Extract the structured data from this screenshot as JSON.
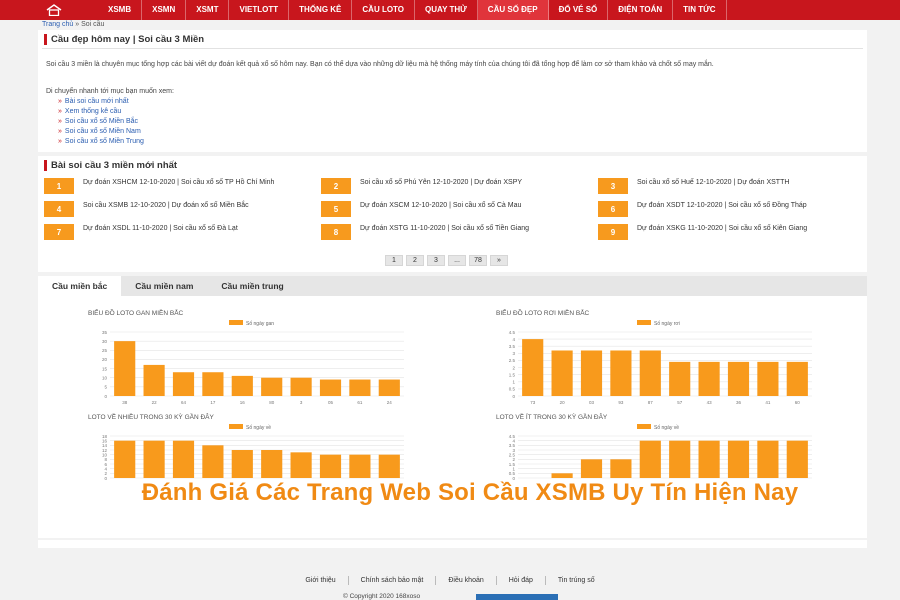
{
  "nav": {
    "items": [
      {
        "label": "XSMB"
      },
      {
        "label": "XSMN"
      },
      {
        "label": "XSMT"
      },
      {
        "label": "VIETLOTT"
      },
      {
        "label": "THỐNG KÊ"
      },
      {
        "label": "CẦU LOTO"
      },
      {
        "label": "QUAY THỬ"
      },
      {
        "label": "CẦU SỐ ĐẸP",
        "active": true
      },
      {
        "label": "ĐỔ VÉ SỐ"
      },
      {
        "label": "ĐIỆN TOÁN"
      },
      {
        "label": "TIN TỨC"
      }
    ],
    "color": "#c8161d"
  },
  "breadcrumb": {
    "home": "Trang chủ",
    "sep": " » ",
    "current": "Soi cầu"
  },
  "intro_panel": {
    "title": "Cầu đẹp hôm nay | Soi cầu 3 Miền",
    "text": "Soi cầu 3 miền là chuyên mục tổng hợp các bài viết dự đoán kết quả xổ số hôm nay. Bạn có thể dựa vào những dữ liệu mà hệ thống máy tính của chúng tôi đã tổng hợp để làm cơ sở tham khảo và chốt số may mắn.",
    "nav_intro": "Di chuyển nhanh tới mục bạn muốn xem:",
    "links": [
      "Bài soi cầu mới nhất",
      "Xem thống kê cầu",
      "Soi cầu xổ số Miền Bắc",
      "Soi cầu xổ số Miền Nam",
      "Soi cầu xổ số Miền Trung"
    ]
  },
  "posts_panel": {
    "title": "Bài soi cầu 3 miền mới nhất",
    "posts": [
      {
        "num": "1",
        "text": "Dự đoán XSHCM 12-10-2020 | Soi cầu xổ số TP Hồ Chí Minh"
      },
      {
        "num": "2",
        "text": "Soi cầu xổ số Phú Yên 12-10-2020 | Dự đoán XSPY"
      },
      {
        "num": "3",
        "text": "Soi cầu xổ số Huế 12-10-2020 | Dự đoán XSTTH"
      },
      {
        "num": "4",
        "text": "Soi cầu XSMB 12-10-2020 | Dự đoán xổ số Miền Bắc"
      },
      {
        "num": "5",
        "text": "Dự đoán XSCM 12-10-2020 | Soi cầu xổ số Cà Mau"
      },
      {
        "num": "6",
        "text": "Dự đoán XSDT 12-10-2020 | Soi cầu xổ số Đồng Tháp"
      },
      {
        "num": "7",
        "text": "Dự đoán XSDL 11-10-2020 | Soi cầu xổ số Đà Lạt"
      },
      {
        "num": "8",
        "text": "Dự đoán XSTG 11-10-2020 | Soi cầu xổ số Tiền Giang"
      },
      {
        "num": "9",
        "text": "Dự đoán XSKG 11-10-2020 | Soi cầu xổ số Kiên Giang"
      }
    ],
    "pager": [
      "1",
      "2",
      "3",
      "...",
      "78",
      "»"
    ],
    "accent": "#f79a1e"
  },
  "stats_panel": {
    "tabs": [
      {
        "label": "Cầu miền bắc",
        "active": true
      },
      {
        "label": "Cầu miền nam"
      },
      {
        "label": "Cầu miền trung"
      }
    ]
  },
  "chart_data": [
    {
      "type": "bar",
      "title": "BIỂU ĐỒ LOTO GAN MIỀN BẮC",
      "series": [
        {
          "name": "Số ngày gan",
          "values": [
            30,
            17,
            13,
            13,
            11,
            10,
            10,
            9,
            9,
            9
          ]
        }
      ],
      "categories": [
        "38",
        "22",
        "64",
        "17",
        "16",
        "80",
        "3",
        "05",
        "61",
        "24"
      ],
      "ylim": [
        0,
        35
      ],
      "yticks": [
        0,
        5,
        10,
        15,
        20,
        25,
        30,
        35
      ],
      "color": "#f89a1c"
    },
    {
      "type": "bar",
      "title": "BIỂU ĐỒ LOTO RƠI MIỀN BẮC",
      "series": [
        {
          "name": "Số ngày rơi",
          "values": [
            4.0,
            3.2,
            3.2,
            3.2,
            3.2,
            2.4,
            2.4,
            2.4,
            2.4,
            2.4
          ]
        }
      ],
      "categories": [
        "73",
        "20",
        "03",
        "93",
        "87",
        "57",
        "43",
        "36",
        "41",
        "60"
      ],
      "ylim": [
        0,
        4.5
      ],
      "yticks": [
        0,
        0.5,
        1.0,
        1.5,
        2.0,
        2.5,
        3.0,
        3.5,
        4.0,
        4.5
      ],
      "color": "#f89a1c"
    },
    {
      "type": "bar",
      "title": "LOTO VỀ NHIỀU TRONG 30 KỲ GẦN ĐÂY",
      "series": [
        {
          "name": "Số ngày về",
          "values": [
            16,
            16,
            16,
            14,
            12,
            12,
            11,
            10,
            10,
            10
          ]
        }
      ],
      "categories": [],
      "ylim": [
        0,
        18
      ],
      "yticks": [
        0,
        2,
        4,
        6,
        8,
        10,
        12,
        14,
        16,
        18
      ],
      "color": "#f89a1c"
    },
    {
      "type": "bar",
      "title": "LOTO VỀ ÍT TRONG 30 KỲ GẦN ĐÂY",
      "series": [
        {
          "name": "Số ngày về",
          "values": [
            0,
            0.5,
            2.0,
            2.0,
            4.0,
            4.0,
            4.0,
            4.0,
            4.0,
            4.0
          ]
        }
      ],
      "categories": [],
      "ylim": [
        0,
        4.5
      ],
      "yticks": [
        0,
        0.5,
        1.0,
        1.5,
        2.0,
        2.5,
        3.0,
        3.5,
        4.0,
        4.5
      ],
      "color": "#f89a1c"
    }
  ],
  "watermark": "Đánh Giá Các Trang Web Soi Cầu XSMB Uy Tín Hiện Nay",
  "footer": {
    "links": [
      "Giới thiệu",
      "Chính sách bảo mật",
      "Điều khoản",
      "Hỏi đáp",
      "Tin trúng số"
    ],
    "copyright": "© Copyright 2020 168xoso"
  }
}
